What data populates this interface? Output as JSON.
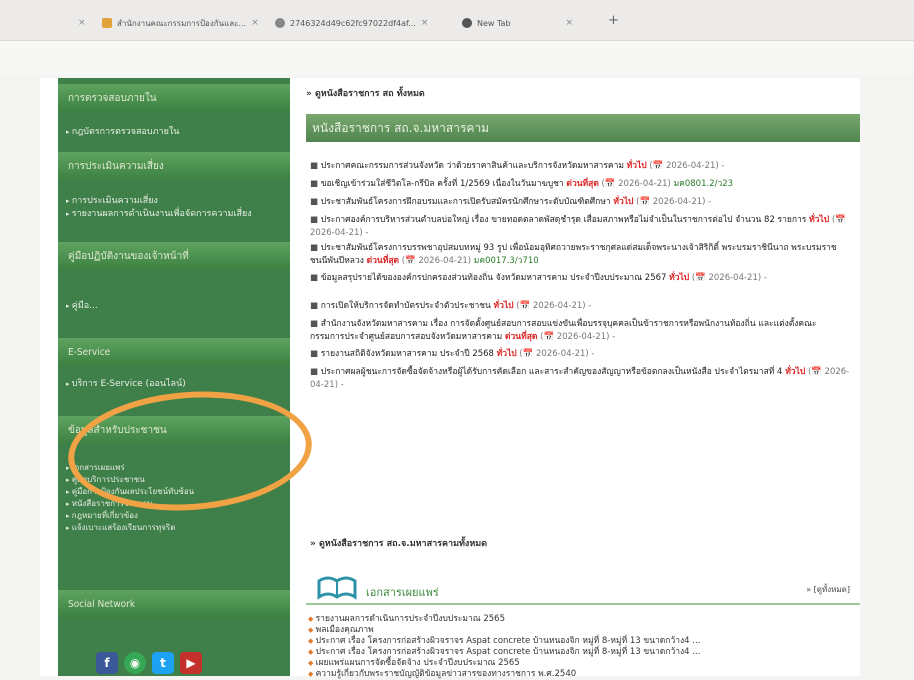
{
  "browser": {
    "tabs": [
      {
        "title": ""
      },
      {
        "title": "สำนักงานคณะกรรมการป้องกันและ..."
      },
      {
        "title": "2746324d49c62fc97022df4af..."
      },
      {
        "title": "New Tab"
      }
    ]
  },
  "sidebar": {
    "sections": [
      {
        "label": "การตรวจสอบภายใน"
      },
      {
        "label": "กฎบัตรการตรวจสอบภายใน"
      },
      {
        "label": "การประเมินความเสี่ยง"
      },
      {
        "label": "คู่มือปฏิบัติงานของเจ้าหน้าที่"
      },
      {
        "label": "E-Service"
      },
      {
        "label": "ข้อมูลสำหรับประชาชน"
      },
      {
        "label": "Social Network"
      }
    ],
    "risk_items": [
      "การประเมินความเสี่ยง",
      "รายงานผลการดำเนินงานเพื่อจัดการความเสี่ยง"
    ],
    "manual_item": "คู่มือ...",
    "eservice_item": "บริการ E-Service (ออนไลน์)",
    "public_items": [
      "เอกสารเผยแพร่",
      "คู่มือบริการประชาชน",
      "คู่มือการป้องกันผลประโยชน์ทับซ้อน",
      "หนังสือราชการจากกรม",
      "กฎหมายที่เกี่ยวข้อง",
      "แจ้งเบาะแสร้องเรียนการทุจริต"
    ]
  },
  "main": {
    "top_link": "ดูหนังสือราชการ สถ ทั้งหมด",
    "section_title": "หนังสือราชการ สถ.จ.มหาสารคาม",
    "tag_general": "ทั่วไป",
    "tag_urgent": "ด่วนที่สุด",
    "news": [
      {
        "text": "ประกาศคณะกรรมการส่วนจังหวัด ว่าด้วยราคาสินค้าและบริการจังหวัดมหาสารคาม",
        "tag": "general",
        "date": "(📅 2026-04-21) -",
        "ref": ""
      },
      {
        "text": "ขอเชิญเข้าร่วมใส่ชีวิตโล-กรีบิล ครั้งที่ 1/2569 เนื่องในวันมาฆบูชา",
        "tag": "urgent",
        "date": "(📅 2026-04-21)",
        "ref": "มค0801.2/ว23"
      },
      {
        "text": "ประชาสัมพันธ์โครงการฝึกอบรมและการเปิดรับสมัครนักศึกษาระดับบัณฑิตศึกษา",
        "tag": "general",
        "date": "(📅 2026-04-21) -",
        "ref": ""
      },
      {
        "text": "ประกาศองค์การบริหารส่วนตำบลบ่อใหญ่ เรื่อง ขายทอดตลาดพัสดุชำรุด เสื่อมสภาพหรือไม่จำเป็นในราชการต่อไป จำนวน 82 รายการ",
        "tag": "general",
        "date": "(📅 2026-04-21) -",
        "ref": ""
      },
      {
        "text": "ประชาสัมพันธ์โครงการบรรพชาอุปสมบทหมู่ 93 รูป เพื่อน้อมอุทิศถวายพระราชกุศลแด่สมเด็จพระนางเจ้าสิริกิติ์ พระบรมราชินีนาถ พระบรมราชชนนีพันปีหลวง",
        "tag": "urgent",
        "date": "(📅 2026-04-21)",
        "ref": "มค0017.3/ว710"
      },
      {
        "text": "ข้อมูลสรุปรายได้ขององค์กรปกครองส่วนท้องถิ่น จังหวัดมหาสารคาม ประจำปีงบประมาณ 2567",
        "tag": "general",
        "date": "(📅 2026-04-21) -",
        "ref": ""
      },
      {
        "text": "การเปิดให้บริการจัดทำบัตรประจำตัวประชาชน",
        "tag": "general",
        "date": "(📅 2026-04-21) -",
        "ref": ""
      },
      {
        "text": "สำนักงานจังหวัดมหาสารคาม เรื่อง การจัดตั้งศูนย์สอบการสอบแข่งขันเพื่อบรรจุบุคคลเป็นข้าราชการหรือพนักงานท้องถิ่น และแต่งตั้งคณะกรรมการประจำศูนย์สอบการสอบจังหวัดมหาสารคาม",
        "tag": "urgent",
        "date": "(📅 2026-04-21) -",
        "ref": ""
      },
      {
        "text": "รายงานสถิติจังหวัดมหาสารคาม ประจำปี 2568",
        "tag": "general",
        "date": "(📅 2026-04-21) -",
        "ref": ""
      },
      {
        "text": "ประกาศผลผู้ชนะการจัดซื้อจัดจ้างหรือผู้ได้รับการคัดเลือก และสาระสำคัญของสัญญาหรือข้อตกลงเป็นหนังสือ ประจำไตรมาสที่ 4",
        "tag": "general",
        "date": "(📅 2026-04-21) -",
        "ref": ""
      }
    ],
    "all_link": "ดูหนังสือราชการ สถ.จ.มหาสารคามทั้งหมด",
    "pub_title": "เอกสารเผยแพร่",
    "pub_all": "» [ดูทั้งหมด]",
    "pub_items": [
      "รายงานผลการดำเนินการประจำปีงบประมาณ 2565",
      "พลเมืองคุณภาพ",
      "ประกาศ เรื่อง โครงการก่อสร้างผิวจราจร Aspat concrete บ้านหนองจิก หมู่ที่ 8-หมู่ที่ 13 ขนาดกว้าง4 ...",
      "ประกาศ เรื่อง โครงการก่อสร้างผิวจราจร Aspat concrete บ้านหนองจิก หมู่ที่ 8-หมู่ที่ 13 ขนาดกว้าง4 ...",
      "เผยแพร่แผนการจัดซื้อจัดจ้าง ประจำปีงบประมาณ 2565",
      "ความรู้เกี่ยวกับพระราชบัญญัติข้อมูลข่าวสารของทางราชการ พ.ศ.2540"
    ]
  },
  "colors": {
    "sidebar": "#3f7f4a",
    "accent": "#f1a244",
    "tag": "#dd2222"
  }
}
